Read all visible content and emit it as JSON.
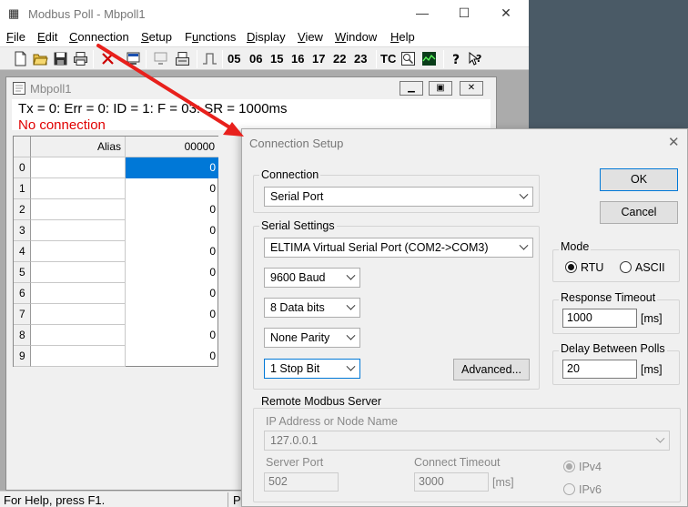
{
  "window": {
    "title": "Modbus Poll - Mbpoll1",
    "controls": {
      "minimize": "—",
      "maximize": "☐",
      "close": "✕"
    }
  },
  "menubar": [
    {
      "label": "File",
      "key": "F",
      "rest": "ile"
    },
    {
      "label": "Edit",
      "key": "E",
      "rest": "dit"
    },
    {
      "label": "Connection",
      "key": "C",
      "rest": "onnection"
    },
    {
      "label": "Setup",
      "key": "S",
      "rest": "etup"
    },
    {
      "label": "Functions",
      "key": "u",
      "pre": "F",
      "rest": "nctions"
    },
    {
      "label": "Display",
      "key": "D",
      "rest": "isplay"
    },
    {
      "label": "View",
      "key": "V",
      "rest": "iew"
    },
    {
      "label": "Window",
      "key": "W",
      "rest": "indow"
    },
    {
      "label": "Help",
      "key": "H",
      "rest": "elp"
    }
  ],
  "toolbar": {
    "function_codes": [
      "05",
      "06",
      "15",
      "16",
      "17",
      "22",
      "23"
    ],
    "tc_label": "TC",
    "icons": [
      "new-icon",
      "open-icon",
      "save-icon",
      "print-icon",
      "disconnect-icon",
      "connect-icon",
      "display-icon",
      "read-write-icon",
      "pulse-icon",
      "traffic-icon",
      "chart-icon",
      "help-icon",
      "context-help-icon"
    ]
  },
  "child": {
    "title": "Mbpoll1",
    "info_line": "Tx = 0: Err = 0: ID = 1: F = 03: SR = 1000ms",
    "status": "No connection",
    "grid": {
      "headers": [
        "Alias",
        "00000"
      ],
      "rows": [
        {
          "index": "0",
          "alias": "",
          "value": "0"
        },
        {
          "index": "1",
          "alias": "",
          "value": "0"
        },
        {
          "index": "2",
          "alias": "",
          "value": "0"
        },
        {
          "index": "3",
          "alias": "",
          "value": "0"
        },
        {
          "index": "4",
          "alias": "",
          "value": "0"
        },
        {
          "index": "5",
          "alias": "",
          "value": "0"
        },
        {
          "index": "6",
          "alias": "",
          "value": "0"
        },
        {
          "index": "7",
          "alias": "",
          "value": "0"
        },
        {
          "index": "8",
          "alias": "",
          "value": "0"
        },
        {
          "index": "9",
          "alias": "",
          "value": "0"
        }
      ]
    }
  },
  "statusbar": {
    "text": "For Help, press F1.",
    "pane2": "Po"
  },
  "dialog": {
    "title": "Connection Setup",
    "connection": {
      "label": "Connection",
      "value": "Serial Port"
    },
    "serial": {
      "label": "Serial Settings",
      "port": "ELTIMA Virtual Serial Port (COM2->COM3)",
      "baud": "9600 Baud",
      "data_bits": "8 Data bits",
      "parity": "None Parity",
      "stop_bits": "1 Stop Bit",
      "advanced": "Advanced..."
    },
    "ok": "OK",
    "cancel": "Cancel",
    "mode": {
      "label": "Mode",
      "rtu": "RTU",
      "ascii": "ASCII",
      "selected": "RTU"
    },
    "response_timeout": {
      "label": "Response Timeout",
      "value": "1000",
      "unit": "[ms]"
    },
    "delay_between_polls": {
      "label": "Delay Between Polls",
      "value": "20",
      "unit": "[ms]"
    },
    "remote": {
      "label": "Remote Modbus Server",
      "ip_label": "IP Address or Node Name",
      "ip_value": "127.0.0.1",
      "server_port_label": "Server Port",
      "server_port_value": "502",
      "connect_timeout_label": "Connect Timeout",
      "connect_timeout_value": "3000",
      "connect_timeout_unit": "[ms]",
      "ipv4": "IPv4",
      "ipv6": "IPv6"
    }
  },
  "colors": {
    "annotation_arrow": "#e8201c",
    "selection": "#0078d7",
    "error_text": "#e00000"
  }
}
